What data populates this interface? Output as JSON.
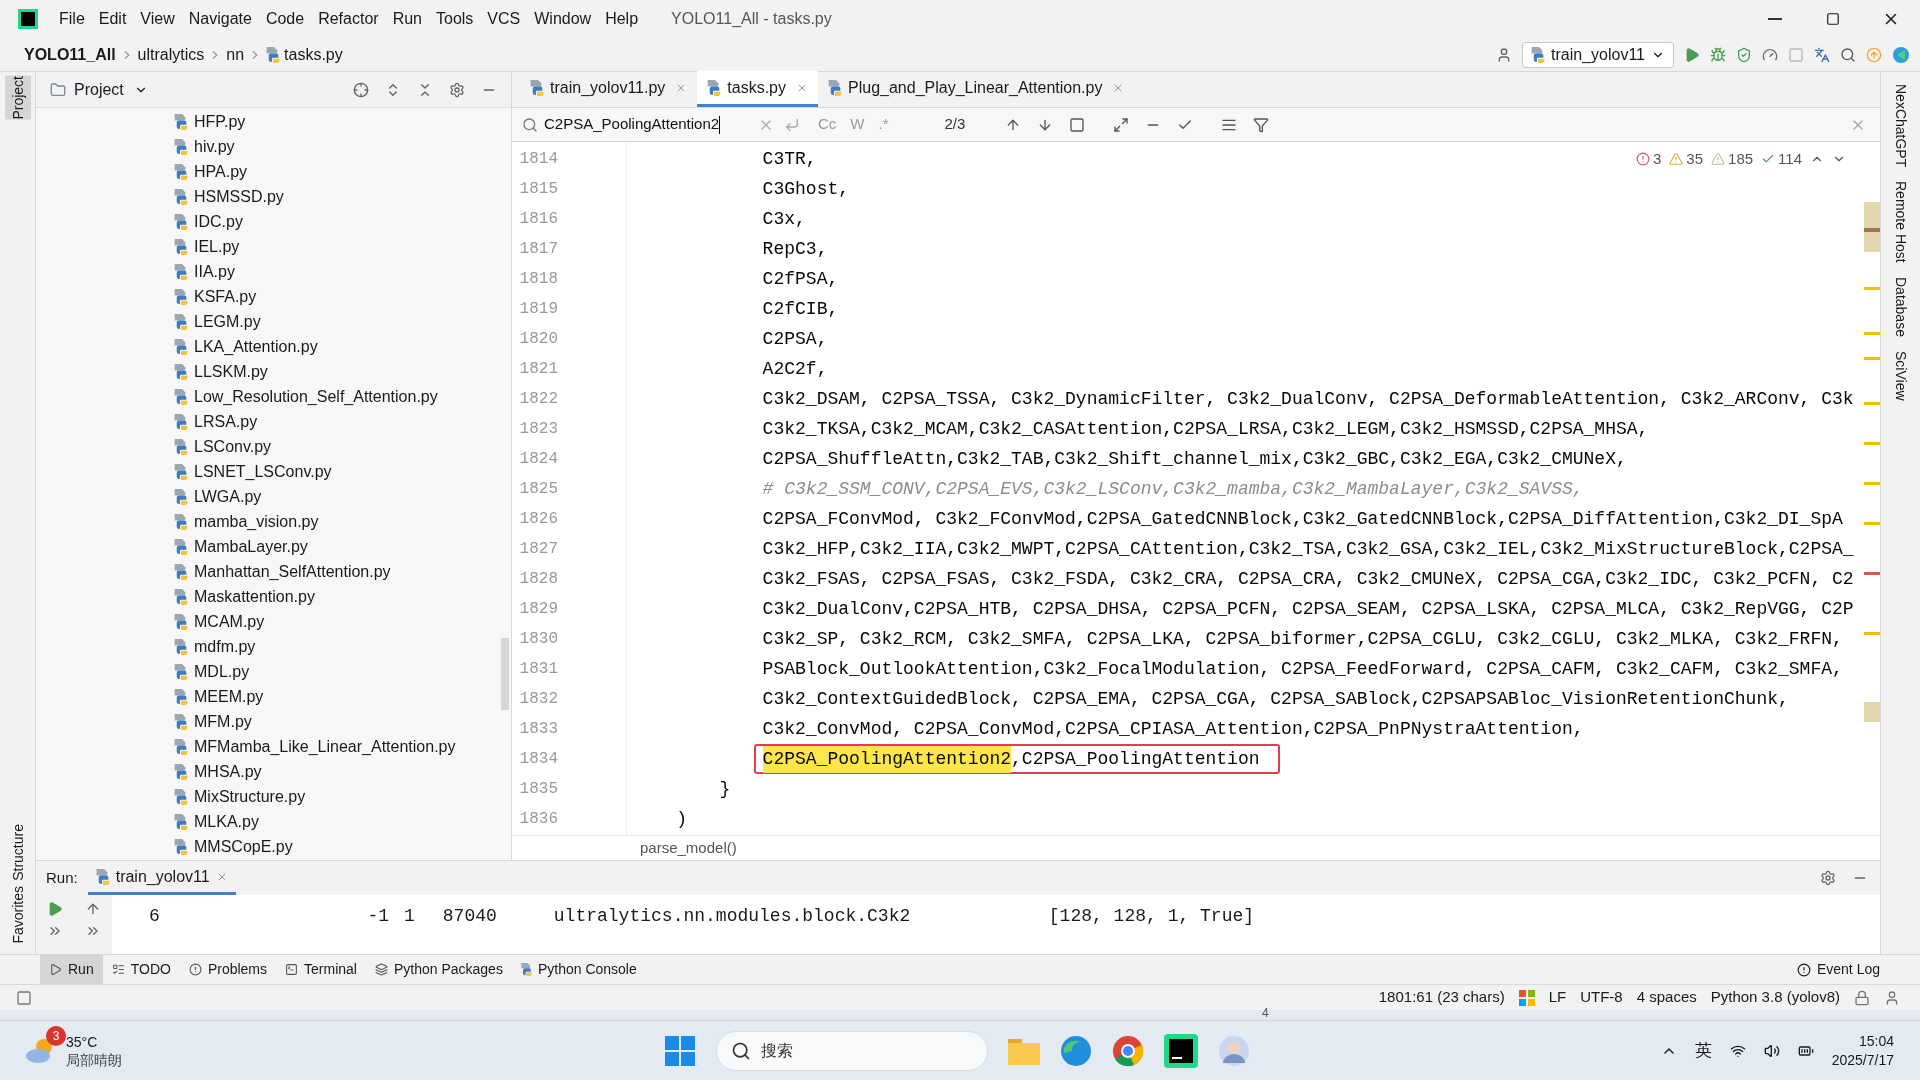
{
  "window": {
    "title": "YOLO11_All - tasks.py"
  },
  "menu": [
    "File",
    "Edit",
    "View",
    "Navigate",
    "Code",
    "Refactor",
    "Run",
    "Tools",
    "VCS",
    "Window",
    "Help"
  ],
  "breadcrumbs": [
    "YOLO11_All",
    "ultralytics",
    "nn",
    "tasks.py"
  ],
  "run_config": "train_yolov11",
  "project_panel": {
    "title": "Project",
    "files": [
      "HFP.py",
      "hiv.py",
      "HPA.py",
      "HSMSSD.py",
      "IDC.py",
      "IEL.py",
      "IIA.py",
      "KSFA.py",
      "LEGM.py",
      "LKA_Attention.py",
      "LLSKM.py",
      "Low_Resolution_Self_Attention.py",
      "LRSA.py",
      "LSConv.py",
      "LSNET_LSConv.py",
      "LWGA.py",
      "mamba_vision.py",
      "MambaLayer.py",
      "Manhattan_SelfAttention.py",
      "Maskattention.py",
      "MCAM.py",
      "mdfm.py",
      "MDL.py",
      "MEEM.py",
      "MFM.py",
      "MFMamba_Like_Linear_Attention.py",
      "MHSA.py",
      "MixStructure.py",
      "MLKA.py",
      "MMSCopE.py"
    ]
  },
  "editor_tabs": [
    {
      "label": "train_yolov11.py",
      "selected": false
    },
    {
      "label": "tasks.py",
      "selected": true
    },
    {
      "label": "Plug_and_Play_Linear_Attention.py",
      "selected": false
    }
  ],
  "find_bar": {
    "query": "C2PSA_PoolingAttention2",
    "match_count": "2/3",
    "options": [
      "Cc",
      "W",
      ".*"
    ]
  },
  "inspections": {
    "errors": "3",
    "warnings": "35",
    "weak_warnings": "185",
    "typos": "114"
  },
  "code_lines": [
    {
      "number": "1814",
      "kind": "code",
      "text": "            C3TR,"
    },
    {
      "number": "1815",
      "kind": "code",
      "text": "            C3Ghost,"
    },
    {
      "number": "1816",
      "kind": "code",
      "text": "            C3x,"
    },
    {
      "number": "1817",
      "kind": "code",
      "text": "            RepC3,"
    },
    {
      "number": "1818",
      "kind": "code",
      "text": "            C2fPSA,"
    },
    {
      "number": "1819",
      "kind": "code",
      "text": "            C2fCIB,"
    },
    {
      "number": "1820",
      "kind": "code",
      "text": "            C2PSA,"
    },
    {
      "number": "1821",
      "kind": "code",
      "text": "            A2C2f,"
    },
    {
      "number": "1822",
      "kind": "code",
      "text": "            C3k2_DSAM, C2PSA_TSSA, C3k2_DynamicFilter, C3k2_DualConv, C2PSA_DeformableAttention, C3k2_ARConv, C3k"
    },
    {
      "number": "1823",
      "kind": "code",
      "text": "            C3k2_TKSA,C3k2_MCAM,C3k2_CASAttention,C2PSA_LRSA,C3k2_LEGM,C3k2_HSMSSD,C2PSA_MHSA,"
    },
    {
      "number": "1824",
      "kind": "code",
      "text": "            C2PSA_ShuffleAttn,C3k2_TAB,C3k2_Shift_channel_mix,C3k2_GBC,C3k2_EGA,C3k2_CMUNeX,"
    },
    {
      "number": "1825",
      "kind": "comment",
      "text": "            # C3k2_SSM_CONV,C2PSA_EVS,C3k2_LSConv,C3k2_mamba,C3k2_MambaLayer,C3k2_SAVSS,"
    },
    {
      "number": "1826",
      "kind": "code",
      "text": "            C2PSA_FConvMod, C3k2_FConvMod,C2PSA_GatedCNNBlock,C3k2_GatedCNNBlock,C2PSA_DiffAttention,C3k2_DI_SpA"
    },
    {
      "number": "1827",
      "kind": "code",
      "text": "            C3k2_HFP,C3k2_IIA,C3k2_MWPT,C2PSA_CAttention,C3k2_TSA,C3k2_GSA,C3k2_IEL,C3k2_MixStructureBlock,C2PSA_"
    },
    {
      "number": "1828",
      "kind": "code",
      "text": "            C3k2_FSAS, C2PSA_FSAS, C3k2_FSDA, C3k2_CRA, C2PSA_CRA, C3k2_CMUNeX, C2PSA_CGA,C3k2_IDC, C3k2_PCFN, C2"
    },
    {
      "number": "1829",
      "kind": "code",
      "text": "            C3k2_DualConv,C2PSA_HTB, C2PSA_DHSA, C2PSA_PCFN, C2PSA_SEAM, C2PSA_LSKA, C2PSA_MLCA, C3k2_RepVGG, C2P"
    },
    {
      "number": "1830",
      "kind": "code",
      "text": "            C3k2_SP, C3k2_RCM, C3k2_SMFA, C2PSA_LKA, C2PSA_biformer,C2PSA_CGLU, C3k2_CGLU, C3k2_MLKA, C3k2_FRFN,"
    },
    {
      "number": "1831",
      "kind": "code",
      "text": "            PSABlock_OutlookAttention,C3k2_FocalModulation, C2PSA_FeedForward, C2PSA_CAFM, C3k2_CAFM, C3k2_SMFA,"
    },
    {
      "number": "1832",
      "kind": "code",
      "text": "            C3k2_ContextGuidedBlock, C2PSA_EMA, C2PSA_CGA, C2PSA_SABlock,C2PSAPSABloc_VisionRetentionChunk,"
    },
    {
      "number": "1833",
      "kind": "code",
      "text": "            C3k2_ConvMod, C2PSA_ConvMod,C2PSA_CPIASA_Attention,C2PSA_PnPNystraAttention,"
    },
    {
      "number": "1834",
      "kind": "match",
      "match": "C2PSA_PoolingAttention2",
      "text": ",C2PSA_PoolingAttention"
    },
    {
      "number": "1835",
      "kind": "code",
      "text": "        }"
    },
    {
      "number": "1836",
      "kind": "code",
      "text": "    )"
    }
  ],
  "code_breadcrumb": "parse_model()",
  "run_panel": {
    "label": "Run:",
    "tab": "train_yolov11",
    "rows": [
      [
        "6",
        "-1",
        "1",
        "87040",
        "ultralytics.nn.modules.block.C3k2",
        "[128, 128, 1, True]"
      ]
    ]
  },
  "tool_tabs": [
    {
      "label": "Run",
      "selected": true
    },
    {
      "label": "TODO",
      "selected": false
    },
    {
      "label": "Problems",
      "selected": false
    },
    {
      "label": "Terminal",
      "selected": false
    },
    {
      "label": "Python Packages",
      "selected": false
    },
    {
      "label": "Python Console",
      "selected": false
    }
  ],
  "event_log": "Event Log",
  "status": [
    "1801:61 (23 chars)",
    "LF",
    "UTF-8",
    "4 spaces",
    "Python 3.8 (yolov8)"
  ],
  "side_tabs_left": [
    {
      "label": "Project",
      "selected": true
    },
    {
      "label": "Structure",
      "selected": false
    },
    {
      "label": "Favorites",
      "selected": false
    }
  ],
  "side_tabs_right": [
    "NexChatGPT",
    "Remote Host",
    "Database",
    "SciView"
  ],
  "desktop_label": "4",
  "taskbar": {
    "weather_badge": "3",
    "temperature": "35°C",
    "weather": "局部晴朗",
    "search_placeholder": "搜索",
    "input_method": "英",
    "time": "15:04",
    "date": "2025/7/17"
  }
}
